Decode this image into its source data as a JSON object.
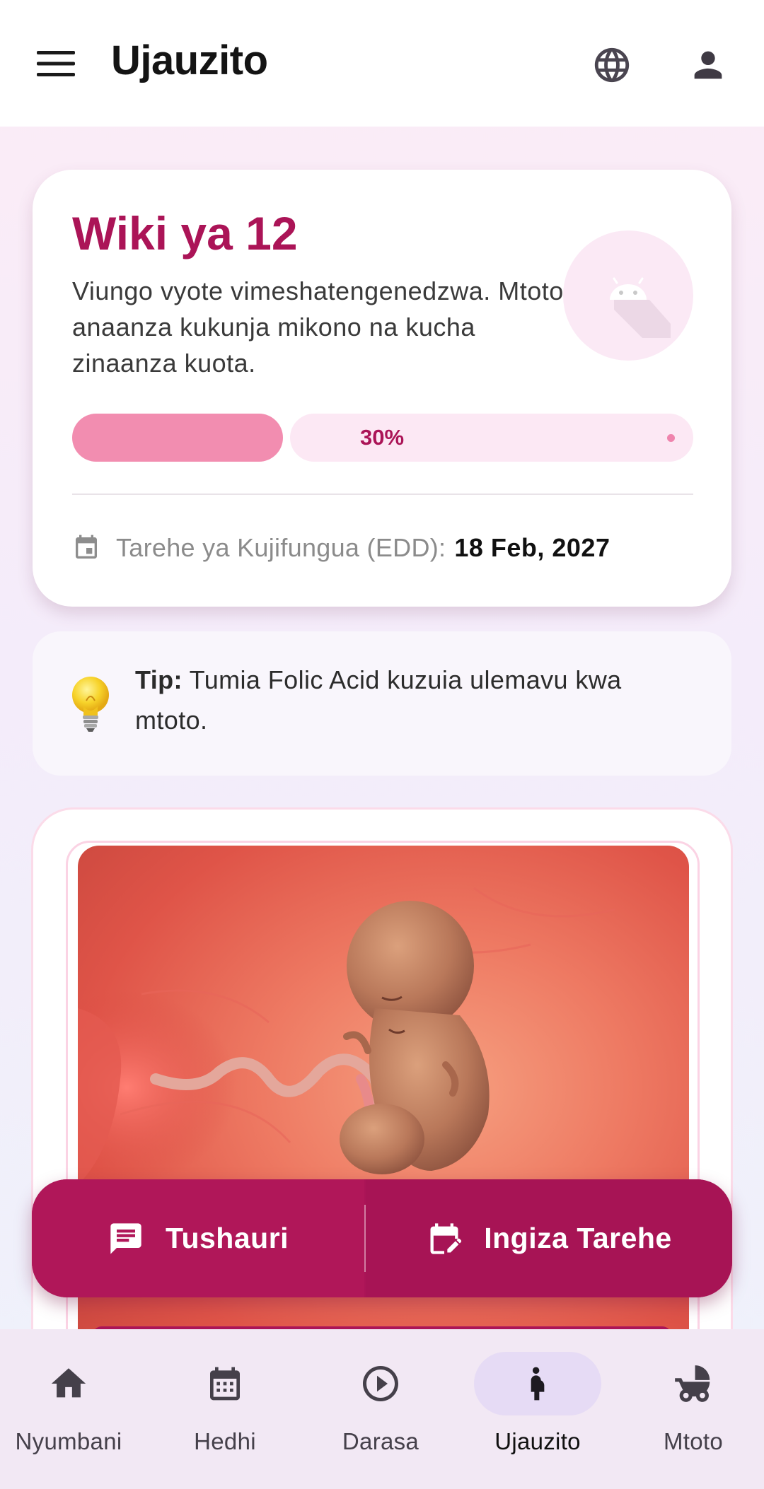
{
  "app_bar": {
    "title": "Ujauzito",
    "menu_icon": "menu-icon",
    "language_icon": "globe-icon",
    "profile_icon": "account-icon"
  },
  "week_card": {
    "title": "Wiki ya 12",
    "description": "Viungo vyote vimeshatengenedzwa. Mtoto anaanza kukunja mikono na kucha zinaanza kuota.",
    "progress": {
      "value_percent": 30,
      "label": "30%"
    },
    "edd": {
      "label": "Tarehe ya Kujifungua (EDD):",
      "value": "18 Feb, 2027"
    }
  },
  "tip": {
    "prefix": "Tip:",
    "text": " Tumia Folic Acid kuzuia ulemavu kwa mtoto."
  },
  "actions": {
    "advice_label": "Tushauri",
    "enter_date_label": "Ingiza Tarehe"
  },
  "bottom_nav": {
    "items": [
      {
        "label": "Nyumbani",
        "icon": "home-icon",
        "active": false
      },
      {
        "label": "Hedhi",
        "icon": "calendar-icon",
        "active": false
      },
      {
        "label": "Darasa",
        "icon": "play-circle-icon",
        "active": false
      },
      {
        "label": "Ujauzito",
        "icon": "pregnant-woman-icon",
        "active": true
      },
      {
        "label": "Mtoto",
        "icon": "stroller-icon",
        "active": false
      }
    ]
  },
  "colors": {
    "brand": "#ab1457",
    "progress_fill": "#f28db0",
    "progress_track": "#fce8f4",
    "nav_active_pill": "#e6dbf5"
  }
}
